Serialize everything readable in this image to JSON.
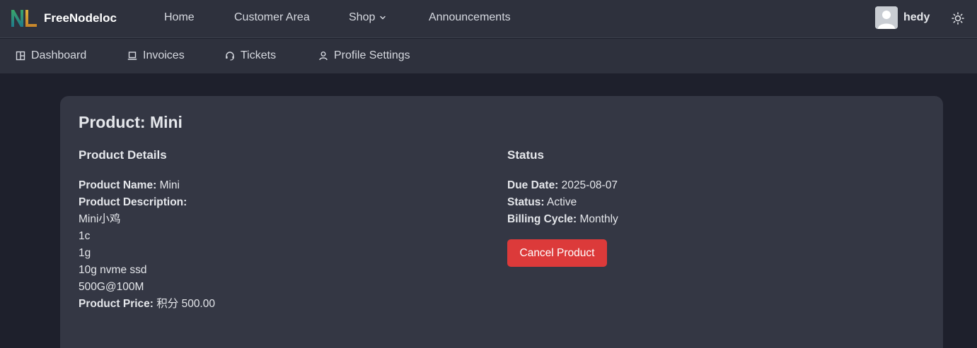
{
  "brand": {
    "name": "FreeNodeloc"
  },
  "topnav": {
    "items": [
      {
        "label": "Home"
      },
      {
        "label": "Customer Area"
      },
      {
        "label": "Shop"
      },
      {
        "label": "Announcements"
      }
    ],
    "user": {
      "name": "hedy"
    }
  },
  "subnav": {
    "items": [
      {
        "label": "Dashboard",
        "icon": "dashboard-icon"
      },
      {
        "label": "Invoices",
        "icon": "laptop-icon"
      },
      {
        "label": "Tickets",
        "icon": "headset-icon"
      },
      {
        "label": "Profile Settings",
        "icon": "user-icon"
      }
    ]
  },
  "product": {
    "title": "Product: Mini",
    "details_heading": "Product Details",
    "name_label": "Product Name:",
    "name_value": "Mini",
    "desc_label": "Product Description:",
    "desc_lines": [
      "Mini小鸡",
      "1c",
      "1g",
      "10g nvme ssd",
      "500G@100M"
    ],
    "price_label": "Product Price:",
    "price_value": "积分 500.00"
  },
  "status": {
    "heading": "Status",
    "due_label": "Due Date:",
    "due_value": "2025-08-07",
    "status_label": "Status:",
    "status_value": "Active",
    "cycle_label": "Billing Cycle:",
    "cycle_value": "Monthly",
    "cancel_label": "Cancel Product"
  },
  "colors": {
    "page_bg": "#1e202c",
    "nav_bg": "#2e313d",
    "card_bg": "#343744",
    "danger": "#dc3a3a"
  }
}
